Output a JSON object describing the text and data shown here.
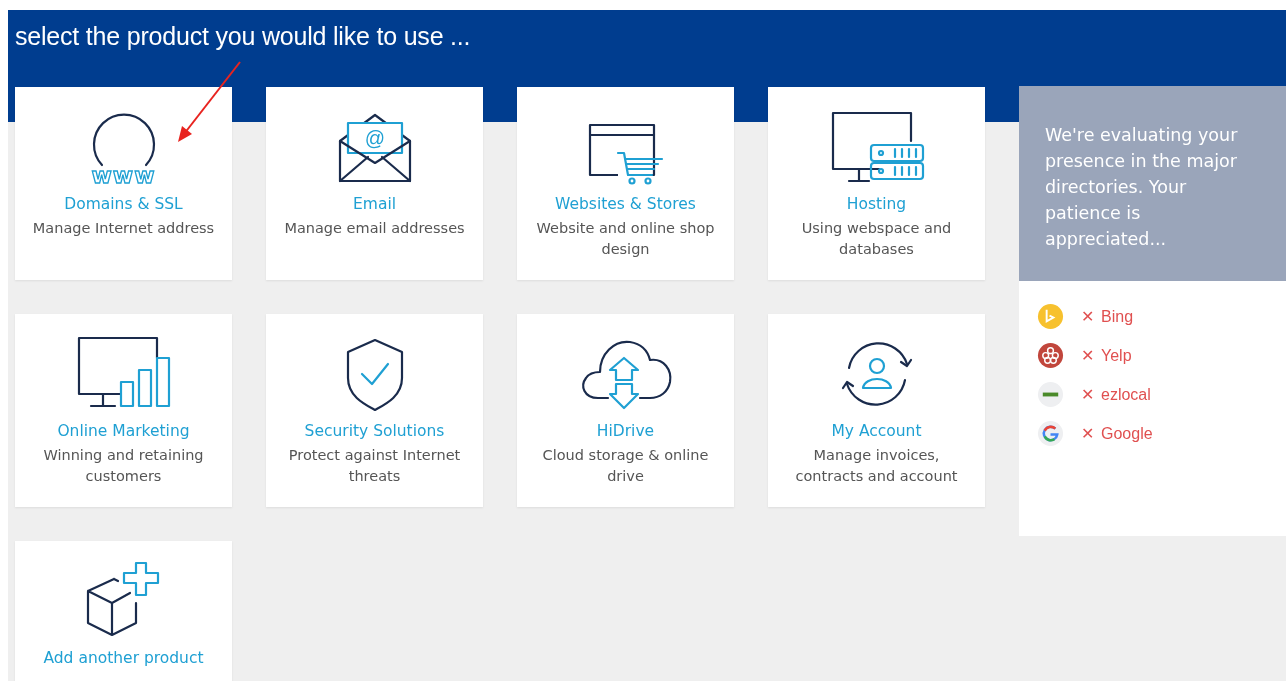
{
  "header": {
    "title": "select the product you would like to use ..."
  },
  "products": [
    {
      "title": "Domains & SSL",
      "description": "Manage Internet address",
      "icon_text": "www"
    },
    {
      "title": "Email",
      "description": "Manage email addresses",
      "icon_text": "@"
    },
    {
      "title": "Websites & Stores",
      "description": "Website and online shop design"
    },
    {
      "title": "Hosting",
      "description": "Using webspace and databases"
    },
    {
      "title": "Online Marketing",
      "description": "Winning and retaining customers"
    },
    {
      "title": "Security Solutions",
      "description": "Protect against Internet threats"
    },
    {
      "title": "HiDrive",
      "description": "Cloud storage & online drive"
    },
    {
      "title": "My Account",
      "description": "Manage invoices, contracts and account"
    },
    {
      "title": "Add another product"
    }
  ],
  "directory_panel": {
    "message": "We're evaluating your presence in the major directories. Your patience is appreciated...",
    "directories": [
      {
        "name": "Bing",
        "status_mark": "✕",
        "listed": false,
        "color": "#f7c12e"
      },
      {
        "name": "Yelp",
        "status_mark": "✕",
        "listed": false,
        "color": "#c1463c"
      },
      {
        "name": "ezlocal",
        "status_mark": "✕",
        "listed": false,
        "color": "#eeeff1"
      },
      {
        "name": "Google",
        "status_mark": "✕",
        "listed": false,
        "color": "#eeeff1"
      }
    ]
  }
}
